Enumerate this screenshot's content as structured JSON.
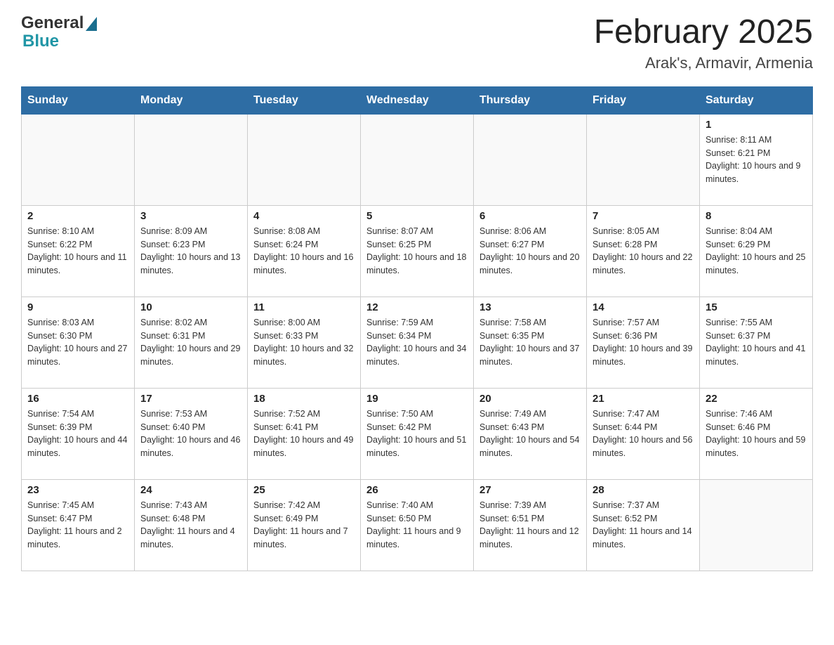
{
  "header": {
    "logo_general": "General",
    "logo_blue": "Blue",
    "title": "February 2025",
    "subtitle": "Arak's, Armavir, Armenia"
  },
  "days_of_week": [
    "Sunday",
    "Monday",
    "Tuesday",
    "Wednesday",
    "Thursday",
    "Friday",
    "Saturday"
  ],
  "weeks": [
    [
      {
        "day": "",
        "info": ""
      },
      {
        "day": "",
        "info": ""
      },
      {
        "day": "",
        "info": ""
      },
      {
        "day": "",
        "info": ""
      },
      {
        "day": "",
        "info": ""
      },
      {
        "day": "",
        "info": ""
      },
      {
        "day": "1",
        "info": "Sunrise: 8:11 AM\nSunset: 6:21 PM\nDaylight: 10 hours and 9 minutes."
      }
    ],
    [
      {
        "day": "2",
        "info": "Sunrise: 8:10 AM\nSunset: 6:22 PM\nDaylight: 10 hours and 11 minutes."
      },
      {
        "day": "3",
        "info": "Sunrise: 8:09 AM\nSunset: 6:23 PM\nDaylight: 10 hours and 13 minutes."
      },
      {
        "day": "4",
        "info": "Sunrise: 8:08 AM\nSunset: 6:24 PM\nDaylight: 10 hours and 16 minutes."
      },
      {
        "day": "5",
        "info": "Sunrise: 8:07 AM\nSunset: 6:25 PM\nDaylight: 10 hours and 18 minutes."
      },
      {
        "day": "6",
        "info": "Sunrise: 8:06 AM\nSunset: 6:27 PM\nDaylight: 10 hours and 20 minutes."
      },
      {
        "day": "7",
        "info": "Sunrise: 8:05 AM\nSunset: 6:28 PM\nDaylight: 10 hours and 22 minutes."
      },
      {
        "day": "8",
        "info": "Sunrise: 8:04 AM\nSunset: 6:29 PM\nDaylight: 10 hours and 25 minutes."
      }
    ],
    [
      {
        "day": "9",
        "info": "Sunrise: 8:03 AM\nSunset: 6:30 PM\nDaylight: 10 hours and 27 minutes."
      },
      {
        "day": "10",
        "info": "Sunrise: 8:02 AM\nSunset: 6:31 PM\nDaylight: 10 hours and 29 minutes."
      },
      {
        "day": "11",
        "info": "Sunrise: 8:00 AM\nSunset: 6:33 PM\nDaylight: 10 hours and 32 minutes."
      },
      {
        "day": "12",
        "info": "Sunrise: 7:59 AM\nSunset: 6:34 PM\nDaylight: 10 hours and 34 minutes."
      },
      {
        "day": "13",
        "info": "Sunrise: 7:58 AM\nSunset: 6:35 PM\nDaylight: 10 hours and 37 minutes."
      },
      {
        "day": "14",
        "info": "Sunrise: 7:57 AM\nSunset: 6:36 PM\nDaylight: 10 hours and 39 minutes."
      },
      {
        "day": "15",
        "info": "Sunrise: 7:55 AM\nSunset: 6:37 PM\nDaylight: 10 hours and 41 minutes."
      }
    ],
    [
      {
        "day": "16",
        "info": "Sunrise: 7:54 AM\nSunset: 6:39 PM\nDaylight: 10 hours and 44 minutes."
      },
      {
        "day": "17",
        "info": "Sunrise: 7:53 AM\nSunset: 6:40 PM\nDaylight: 10 hours and 46 minutes."
      },
      {
        "day": "18",
        "info": "Sunrise: 7:52 AM\nSunset: 6:41 PM\nDaylight: 10 hours and 49 minutes."
      },
      {
        "day": "19",
        "info": "Sunrise: 7:50 AM\nSunset: 6:42 PM\nDaylight: 10 hours and 51 minutes."
      },
      {
        "day": "20",
        "info": "Sunrise: 7:49 AM\nSunset: 6:43 PM\nDaylight: 10 hours and 54 minutes."
      },
      {
        "day": "21",
        "info": "Sunrise: 7:47 AM\nSunset: 6:44 PM\nDaylight: 10 hours and 56 minutes."
      },
      {
        "day": "22",
        "info": "Sunrise: 7:46 AM\nSunset: 6:46 PM\nDaylight: 10 hours and 59 minutes."
      }
    ],
    [
      {
        "day": "23",
        "info": "Sunrise: 7:45 AM\nSunset: 6:47 PM\nDaylight: 11 hours and 2 minutes."
      },
      {
        "day": "24",
        "info": "Sunrise: 7:43 AM\nSunset: 6:48 PM\nDaylight: 11 hours and 4 minutes."
      },
      {
        "day": "25",
        "info": "Sunrise: 7:42 AM\nSunset: 6:49 PM\nDaylight: 11 hours and 7 minutes."
      },
      {
        "day": "26",
        "info": "Sunrise: 7:40 AM\nSunset: 6:50 PM\nDaylight: 11 hours and 9 minutes."
      },
      {
        "day": "27",
        "info": "Sunrise: 7:39 AM\nSunset: 6:51 PM\nDaylight: 11 hours and 12 minutes."
      },
      {
        "day": "28",
        "info": "Sunrise: 7:37 AM\nSunset: 6:52 PM\nDaylight: 11 hours and 14 minutes."
      },
      {
        "day": "",
        "info": ""
      }
    ]
  ]
}
